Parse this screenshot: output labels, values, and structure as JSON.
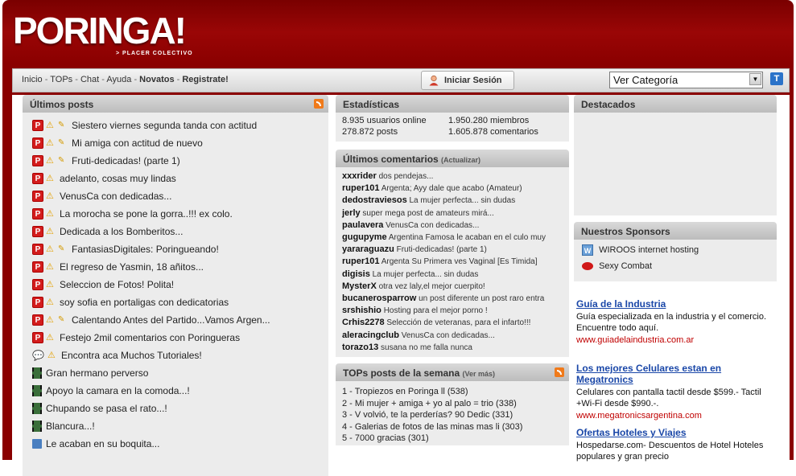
{
  "header": {
    "logo": "PORINGA!",
    "slogan": "> PLACER COLECTIVO"
  },
  "nav": {
    "links": [
      "Inicio",
      "TOPs",
      "Chat",
      "Ayuda",
      "Novatos",
      "Registrate!"
    ],
    "separator": " - ",
    "login_button": "Iniciar Sesión",
    "category_select": "Ver Categoría",
    "t_button": "T"
  },
  "latest_posts": {
    "title": "Últimos posts",
    "items": [
      {
        "text": "Siestero viernes segunda tanda con actitud",
        "icons": [
          "p",
          "warn",
          "key"
        ]
      },
      {
        "text": "Mi amiga con actitud de nuevo",
        "icons": [
          "p",
          "warn",
          "key"
        ]
      },
      {
        "text": "Fruti-dedicadas! (parte 1)",
        "icons": [
          "p",
          "warn",
          "key"
        ]
      },
      {
        "text": "adelanto, cosas muy lindas",
        "icons": [
          "p",
          "warn"
        ]
      },
      {
        "text": "VenusCa con dedicadas...",
        "icons": [
          "p",
          "warn"
        ]
      },
      {
        "text": "La morocha se pone la gorra..!!! ex colo.",
        "icons": [
          "p",
          "warn"
        ]
      },
      {
        "text": "Dedicada a los Bomberitos...",
        "icons": [
          "p",
          "warn"
        ]
      },
      {
        "text": "FantasiasDigitales: Poringueando!",
        "icons": [
          "p",
          "warn",
          "key"
        ]
      },
      {
        "text": "El regreso de Yasmin, 18 añitos...",
        "icons": [
          "p",
          "warn"
        ]
      },
      {
        "text": "Seleccion de Fotos! Polita!",
        "icons": [
          "p",
          "warn"
        ]
      },
      {
        "text": "soy sofia en portaligas con dedicatorias",
        "icons": [
          "p",
          "warn"
        ]
      },
      {
        "text": "Calentando Antes del Partido...Vamos Argen...",
        "icons": [
          "p",
          "warn",
          "key"
        ]
      },
      {
        "text": "Festejo 2mil comentarios con Poringueras",
        "icons": [
          "p",
          "warn"
        ]
      },
      {
        "text": "Encontra aca Muchos Tutoriales!",
        "icons": [
          "chat",
          "warn"
        ]
      },
      {
        "text": "Gran hermano perverso",
        "icons": [
          "film"
        ]
      },
      {
        "text": "Apoyo la camara en la comoda...!",
        "icons": [
          "film"
        ]
      },
      {
        "text": "Chupando se pasa el rato...!",
        "icons": [
          "film"
        ]
      },
      {
        "text": "Blancura...!",
        "icons": [
          "film"
        ]
      },
      {
        "text": "Le acaban en su boquita...",
        "icons": [
          "disk"
        ]
      }
    ]
  },
  "stats": {
    "title": "Estadísticas",
    "online": "8.935 usuarios online",
    "members": "1.950.280 miembros",
    "posts": "278.872 posts",
    "comments": "1.605.878 comentarios"
  },
  "latest_comments": {
    "title": "Últimos comentarios",
    "refresh": "(Actualizar)",
    "items": [
      {
        "user": "xxxrider",
        "text": "dos pendejas..."
      },
      {
        "user": "ruper101",
        "text": "Argenta; Ayy dale que acabo (Amateur)"
      },
      {
        "user": "dedostraviesos",
        "text": "La mujer perfecta... sin dudas"
      },
      {
        "user": "jerly",
        "text": "super mega post de amateurs mirá..."
      },
      {
        "user": "paulavera",
        "text": "VenusCa con dedicadas..."
      },
      {
        "user": "gugupyme",
        "text": "Argentina Famosa le acaban en el culo muy"
      },
      {
        "user": "yararaguazu",
        "text": "Fruti-dedicadas! (parte 1)"
      },
      {
        "user": "ruper101",
        "text": "Argenta Su Primera ves Vaginal [Es Timida]"
      },
      {
        "user": "digisis",
        "text": "La mujer perfecta... sin dudas"
      },
      {
        "user": "MysterX",
        "text": "otra vez laly,el mejor cuerpito!"
      },
      {
        "user": "bucanerosparrow",
        "text": "un post diferente un post raro entra"
      },
      {
        "user": "srshishio",
        "text": "Hosting para el mejor porno !"
      },
      {
        "user": "Crhis2278",
        "text": "Selección de veteranas, para el infarto!!!"
      },
      {
        "user": "aleracingclub",
        "text": "VenusCa con dedicadas..."
      },
      {
        "user": "torazo13",
        "text": "susana no me falla nunca"
      }
    ]
  },
  "top_posts": {
    "title": "TOPs posts de la semana",
    "more": "(Ver más)",
    "items": [
      "1 - Tropiezos en Poringa ll (538)",
      "2 - Mi mujer + amiga + yo al palo = trio (338)",
      "3 - V volvió, te la perderías? 90 Dedic (331)",
      "4 - Galerias de fotos de las minas mas li (303)",
      "5 - 7000 gracias (301)"
    ]
  },
  "featured": {
    "title": "Destacados"
  },
  "sponsors": {
    "title": "Nuestros Sponsors",
    "items": [
      {
        "name": "WIROOS internet hosting",
        "icon": "w-icon"
      },
      {
        "name": "Sexy Combat",
        "icon": "lips-icon"
      }
    ]
  },
  "ads": [
    {
      "title": "Guía de la Industria",
      "desc": "Guía especializada en la industria y el comercio. Encuentre todo aquí.",
      "url": "www.guiadelaindustria.com.ar"
    },
    {
      "title": "Los mejores Celulares estan en Megatronics",
      "desc": "Celulares con pantalla tactil desde $599.- Tactil +Wi-Fi desde $990.-.",
      "url": "www.megatronicsargentina.com"
    },
    {
      "title": "Ofertas Hoteles y Viajes",
      "desc": "Hospedarse.com- Descuentos de Hotel Hoteles populares y gran precio",
      "url": ""
    }
  ],
  "colors": {
    "header_red": "#8a0000",
    "ad_link": "#1a47a8",
    "ad_url": "#c00000"
  }
}
